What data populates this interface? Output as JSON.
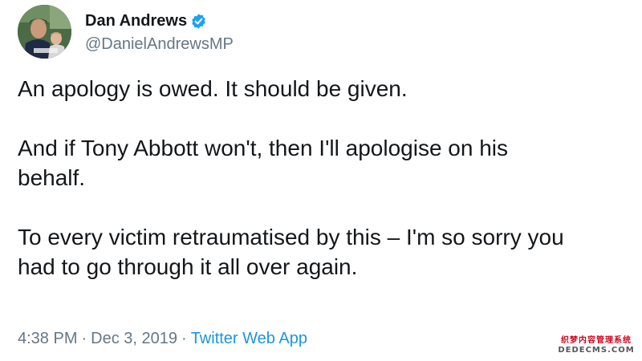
{
  "tweet": {
    "author": {
      "display_name": "Dan Andrews",
      "handle": "@DanielAndrewsMP",
      "verified": true
    },
    "paragraphs": [
      [
        "An apology is owed. It should be given."
      ],
      [
        "And if Tony Abbott won't, then I'll apologise on his",
        "behalf."
      ],
      [
        "To every victim retraumatised by this – I'm so sorry you",
        "had to go through it all over again."
      ]
    ],
    "meta": {
      "time": "4:38 PM",
      "separator": "·",
      "date": "Dec 3, 2019",
      "source": "Twitter Web App"
    }
  },
  "watermark": {
    "line1": "织梦内容管理系统",
    "line2": "DEDECMS.COM"
  },
  "colors": {
    "text": "#14171a",
    "secondary": "#657786",
    "link": "#1b95e0",
    "verified_badge": "#1da1f2"
  }
}
